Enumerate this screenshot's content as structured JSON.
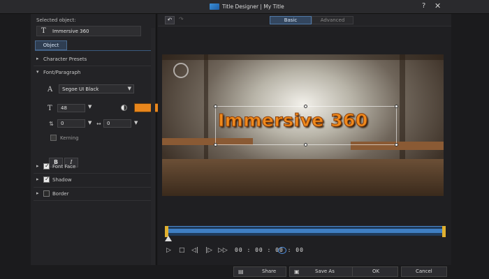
{
  "window": {
    "title": "Title Designer | My Title",
    "help": "?",
    "close": "✕"
  },
  "left_panel": {
    "selected_object_label": "Selected object:",
    "selected_object_value": "Immersive 360",
    "tab_object": "Object",
    "sections": {
      "character_presets": "Character Presets",
      "font_paragraph": "Font/Paragraph",
      "font_face": "Font Face",
      "shadow": "Shadow",
      "border": "Border"
    },
    "font_name": "Segoe UI Black",
    "font_size": "48",
    "font_color": "#e8861c",
    "line_spacing": "0",
    "char_spacing": "0",
    "kerning_label": "Kerning",
    "bold_label": "B",
    "italic_label": "I"
  },
  "toolbar": {
    "tab_basic": "Basic",
    "tab_advanced": "Advanced"
  },
  "preview": {
    "title_text": "Immersive 360"
  },
  "playback": {
    "timecode": "00 : 00 : 00 : 00"
  },
  "footer": {
    "share": "Share",
    "save_as": "Save As",
    "ok": "OK",
    "cancel": "Cancel"
  }
}
